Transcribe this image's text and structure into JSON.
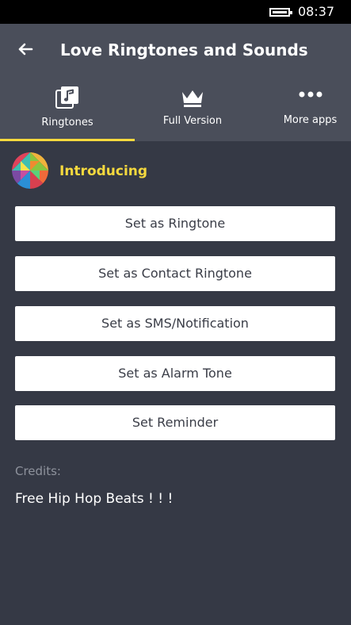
{
  "status_bar": {
    "time": "08:37",
    "battery_icon": "battery-full-icon"
  },
  "header": {
    "back_icon": "back-arrow-icon",
    "title": "Love Ringtones and Sounds"
  },
  "tabs": [
    {
      "label": "Ringtones",
      "icon": "music-library-icon",
      "selected": true
    },
    {
      "label": "Full Version",
      "icon": "crown-icon",
      "selected": false
    },
    {
      "label": "More apps",
      "icon": "more-dots-icon",
      "selected": false
    }
  ],
  "intro": {
    "logo_icon": "triangle-mosaic-logo",
    "label": "Introducing"
  },
  "actions": [
    {
      "label": "Set as Ringtone"
    },
    {
      "label": "Set as Contact Ringtone"
    },
    {
      "label": "Set as SMS/Notification"
    },
    {
      "label": "Set as Alarm Tone"
    },
    {
      "label": "Set Reminder"
    }
  ],
  "credits": {
    "label": "Credits:",
    "value": "Free Hip Hop Beats ! ! !"
  },
  "colors": {
    "background": "#353945",
    "header": "#4a4e5a",
    "accent": "#f5d93e",
    "button": "#ffffff",
    "button_text": "#3a3d47",
    "muted_text": "#8e929c"
  }
}
